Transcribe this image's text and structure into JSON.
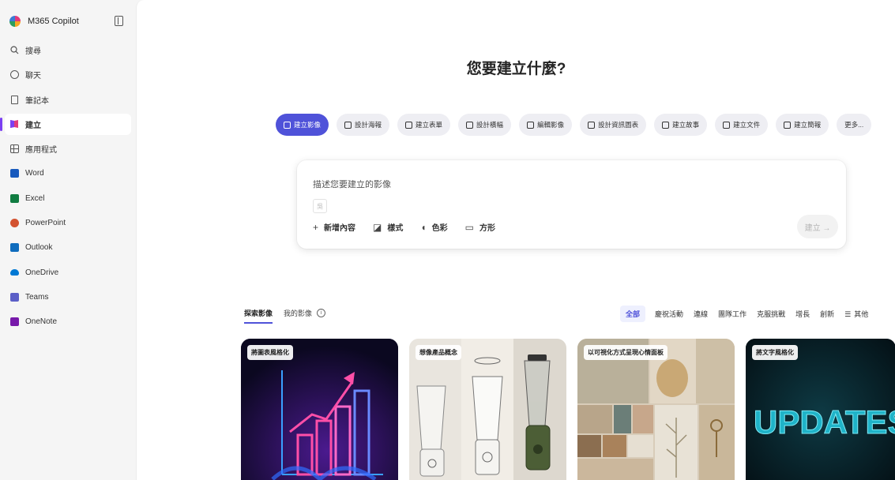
{
  "sidebar": {
    "brand": "M365 Copilot",
    "items": [
      {
        "label": "搜尋",
        "icon": "search-icon"
      },
      {
        "label": "聊天",
        "icon": "chat-icon"
      },
      {
        "label": "筆記本",
        "icon": "notebook-icon"
      },
      {
        "label": "建立",
        "icon": "create-icon",
        "active": true
      },
      {
        "label": "應用程式",
        "icon": "apps-icon"
      },
      {
        "label": "Word",
        "icon": "word-icon",
        "color": "#185abd"
      },
      {
        "label": "Excel",
        "icon": "excel-icon",
        "color": "#107c41"
      },
      {
        "label": "PowerPoint",
        "icon": "powerpoint-icon",
        "color": "#d35230"
      },
      {
        "label": "Outlook",
        "icon": "outlook-icon",
        "color": "#0f6cbd"
      },
      {
        "label": "OneDrive",
        "icon": "onedrive-icon",
        "color": "#0078d4"
      },
      {
        "label": "Teams",
        "icon": "teams-icon",
        "color": "#5b5fc7"
      },
      {
        "label": "OneNote",
        "icon": "onenote-icon",
        "color": "#7719aa"
      }
    ]
  },
  "main": {
    "heading": "您要建立什麼?",
    "pills": [
      "建立影像",
      "設計海報",
      "建立表單",
      "設計橫幅",
      "編輯影像",
      "設計資訊圖表",
      "建立故事",
      "建立文件",
      "建立簡報",
      "更多..."
    ],
    "prompt": {
      "placeholder": "描述您要建立的影像",
      "mini": "吳",
      "tools": [
        "新增內容",
        "樣式",
        "色彩",
        "方形"
      ],
      "submit": "建立 →"
    },
    "explore_tabs": [
      "探索影像",
      "我的影像"
    ],
    "filters": [
      "全部",
      "慶祝活動",
      "連線",
      "團隊工作",
      "克服挑戰",
      "增長",
      "創新",
      "其他"
    ],
    "cards": [
      "將圖表風格化",
      "想像產品概念",
      "以可視化方式呈現心情面板",
      "將文字風格化"
    ],
    "card_texts": {
      "updates": "UPDATES"
    }
  },
  "colors": {
    "accent": "#4f52d9",
    "active_bar": "#7b3ff2"
  }
}
